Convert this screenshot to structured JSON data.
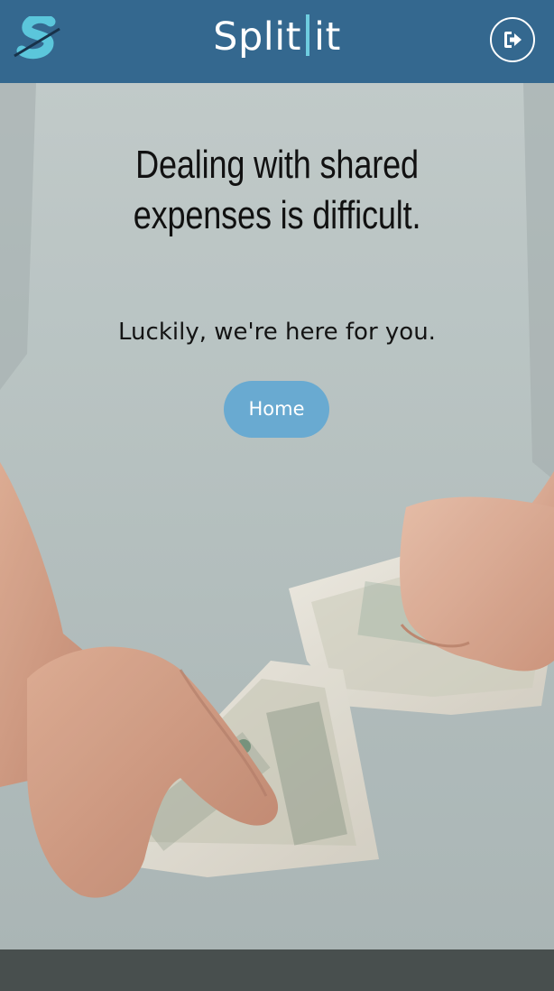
{
  "header": {
    "brand_left": "Split",
    "brand_right": "it",
    "logo_icon": "splitit-logo-icon",
    "logout_icon": "sign-out-icon"
  },
  "hero": {
    "headline": "Dealing with shared expenses is difficult.",
    "subline": "Luckily, we're here for you.",
    "home_button": "Home",
    "background_image": "person-holding-dollar-bills-photo"
  },
  "colors": {
    "navbar": "#34688f",
    "brand_bar": "#6ecde0",
    "button": "#69aad1",
    "headline": "#111111"
  }
}
